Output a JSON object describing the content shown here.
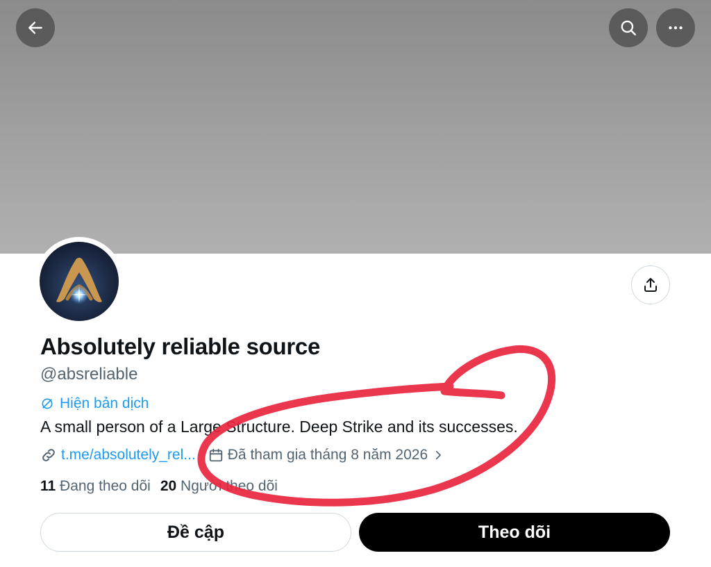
{
  "header": {
    "back_icon": "arrow-left-icon",
    "search_icon": "search-icon",
    "more_icon": "more-horizontal-icon"
  },
  "profile": {
    "display_name": "Absolutely reliable source",
    "handle": "@absreliable",
    "translate_label": "Hiện bản dịch",
    "bio": "A small person of a Large Structure. Deep Strike and its successes.",
    "link": "t.me/absolutely_rel...",
    "joined": "Đã tham gia tháng 8 năm 2026",
    "following_count": "11",
    "following_label": "Đang theo dõi",
    "followers_count": "20",
    "followers_label": "Người theo dõi"
  },
  "actions": {
    "mention_label": "Đề cập",
    "follow_label": "Theo dõi"
  },
  "colors": {
    "accent": "#1d9bf0",
    "annotation": "#e8263f"
  }
}
